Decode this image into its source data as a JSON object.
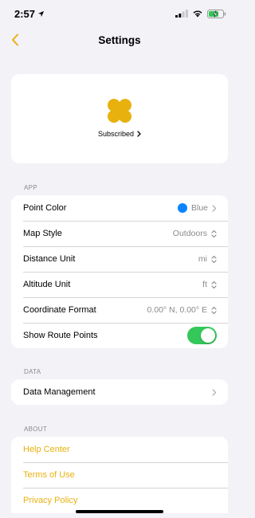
{
  "status_bar": {
    "time": "2:57"
  },
  "nav": {
    "title": "Settings"
  },
  "subscription": {
    "label": "Subscribed"
  },
  "sections": {
    "app": {
      "header": "APP",
      "point_color": {
        "label": "Point Color",
        "value": "Blue",
        "color": "#0a84ff"
      },
      "map_style": {
        "label": "Map Style",
        "value": "Outdoors"
      },
      "distance_unit": {
        "label": "Distance Unit",
        "value": "mi"
      },
      "altitude_unit": {
        "label": "Altitude Unit",
        "value": "ft"
      },
      "coordinate_format": {
        "label": "Coordinate Format",
        "value": "0.00° N, 0.00° E"
      },
      "show_route_points": {
        "label": "Show Route Points",
        "enabled": true
      }
    },
    "data": {
      "header": "DATA",
      "data_management": {
        "label": "Data Management"
      }
    },
    "about": {
      "header": "ABOUT",
      "items": [
        "Help Center",
        "Terms of Use",
        "Privacy Policy"
      ]
    }
  },
  "colors": {
    "accent": "#e8b10e",
    "toggle_on": "#34c759",
    "background": "#f2f2f7"
  }
}
